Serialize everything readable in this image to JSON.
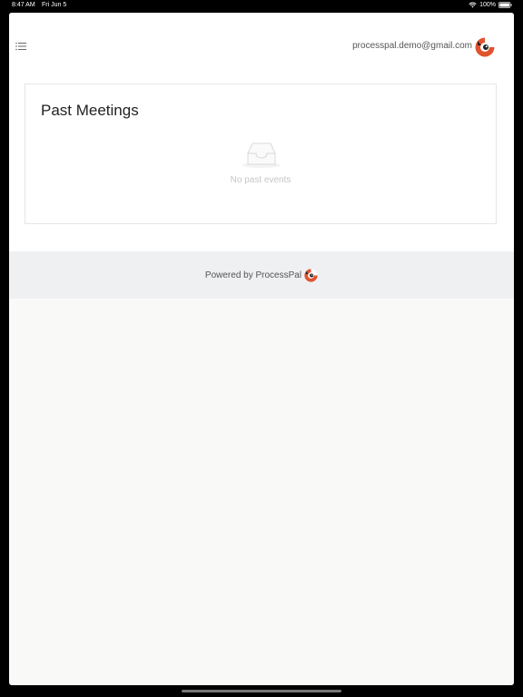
{
  "status_bar": {
    "time": "8:47 AM",
    "date": "Fri Jun 5",
    "battery": "100%",
    "icons": [
      "wifi-icon",
      "battery-icon"
    ]
  },
  "header": {
    "menu_icon": "list-icon",
    "user_email": "processpal.demo@gmail.com",
    "avatar_icon": "processpal-logo-icon"
  },
  "card": {
    "title": "Past Meetings",
    "empty_icon": "empty-inbox-icon",
    "empty_text": "No past events"
  },
  "footer": {
    "text": "Powered by ProcessPal",
    "logo_icon": "processpal-logo-icon"
  },
  "colors": {
    "brand_orange": "#e0532e",
    "background": "#f9f9f8",
    "footer_bg": "#eff0f2"
  }
}
